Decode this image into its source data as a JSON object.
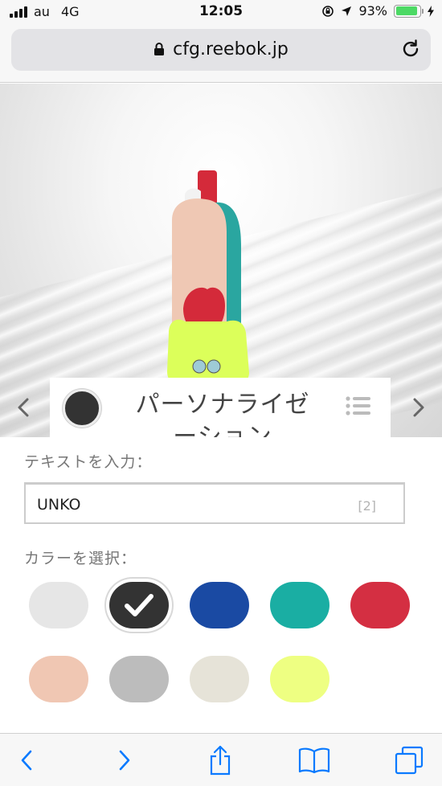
{
  "status_bar": {
    "carrier": "au",
    "network": "4G",
    "time": "12:05",
    "battery_percent": "93%",
    "battery_level": 0.93
  },
  "browser": {
    "url": "cfg.reebok.jp"
  },
  "customizer": {
    "section_title": "パーソナライゼーション",
    "selected_color": "#333333",
    "text_label": "テキストを入力：",
    "text_value": "UNKO",
    "char_count": "[2]",
    "color_label": "カラーを選択：",
    "colors": [
      {
        "name": "light-gray",
        "hex": "#e6e6e6"
      },
      {
        "name": "black",
        "hex": "#333333",
        "selected": true
      },
      {
        "name": "blue",
        "hex": "#1a4aa3"
      },
      {
        "name": "teal",
        "hex": "#1aaea3"
      },
      {
        "name": "red",
        "hex": "#d42f42"
      },
      {
        "name": "peach",
        "hex": "#f0c7b3"
      },
      {
        "name": "gray",
        "hex": "#bcbcbc"
      },
      {
        "name": "cream",
        "hex": "#e6e3d8"
      },
      {
        "name": "lime",
        "hex": "#eeff82"
      }
    ]
  },
  "icons": {
    "lock": "lock-icon",
    "reload": "reload-icon",
    "prev": "chevron-left-icon",
    "next": "chevron-right-icon",
    "list": "list-icon",
    "back": "back-icon",
    "forward": "forward-icon",
    "share": "share-icon",
    "bookmarks": "bookmarks-icon",
    "tabs": "tabs-icon"
  },
  "accent_color": "#0a7aff"
}
